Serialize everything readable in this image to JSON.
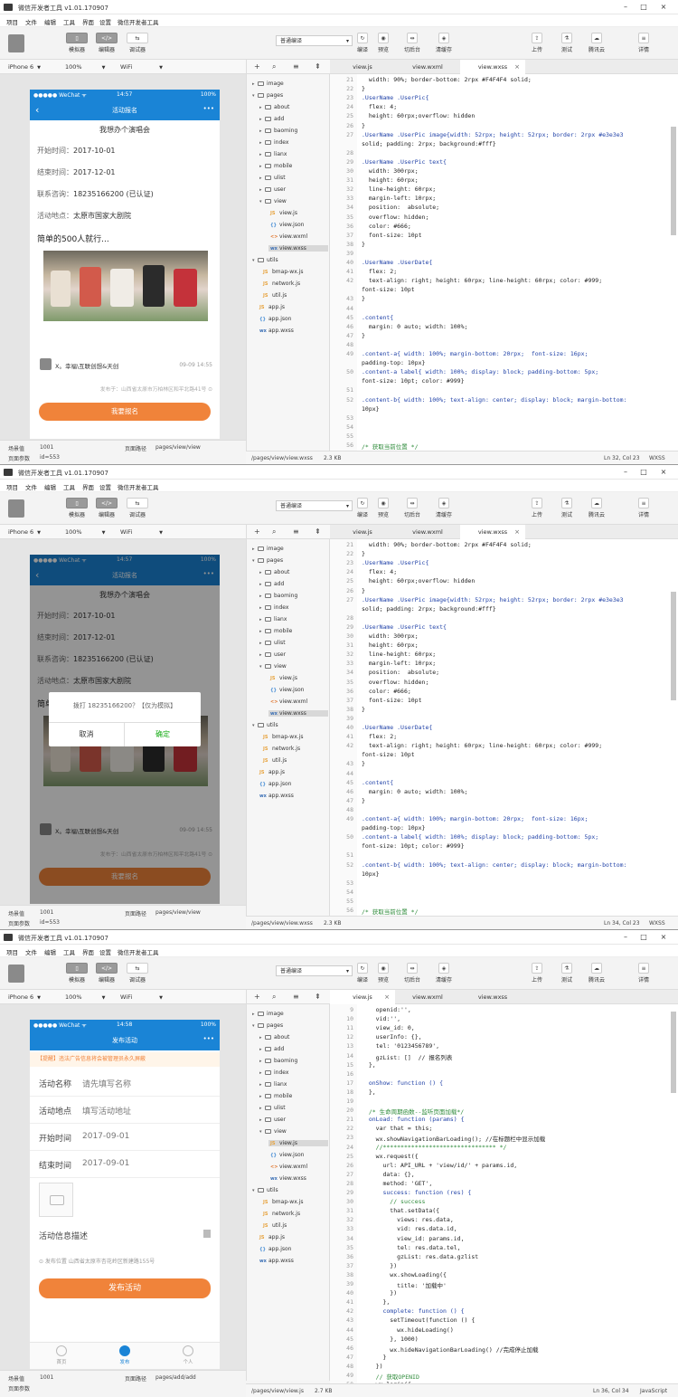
{
  "common": {
    "title": "微信开发者工具 v1.01.170907",
    "menus": [
      "项目",
      "文件",
      "编辑",
      "工具",
      "界面",
      "设置",
      "微信开发者工具"
    ],
    "toolbar": {
      "simulator": "模拟器",
      "editor": "编辑器",
      "debugger": "调试器",
      "mode": "普通编译",
      "compile": "编译",
      "preview": "预览",
      "background": "切后台",
      "cache": "清缓存",
      "upload": "上传",
      "test": "测试",
      "cloud": "腾讯云",
      "details": "详情"
    },
    "device": {
      "model": "iPhone 6",
      "zoom": "100%",
      "network": "WiFi"
    },
    "footer": {
      "scene_label": "场景值",
      "scene_value": "1001",
      "params_label": "页面参数",
      "path_label": "页面路径"
    },
    "files": {
      "image": "image",
      "pages": "pages",
      "about": "about",
      "add": "add",
      "baoming": "baoming",
      "index": "index",
      "lianx": "lianx",
      "mobile": "mobile",
      "ulist": "ulist",
      "user": "user",
      "view": "view",
      "view_js": "view.js",
      "view_json": "view.json",
      "view_wxml": "view.wxml",
      "view_wxss": "view.wxss",
      "utils": "utils",
      "bmap": "bmap-wx.js",
      "network": "network.js",
      "util": "util.js",
      "app_js": "app.js",
      "app_json": "app.json",
      "app_wxss": "app.wxss"
    },
    "tabs": [
      "view.js",
      "view.wxml",
      "view.wxss"
    ],
    "status_brand": "●●●●● WeChat ᯤ",
    "battery": "100%"
  },
  "panel1": {
    "time": "14:57",
    "nav_title": "活动报名",
    "event_title": "我想办个演唱会",
    "start_k": "开始时间：",
    "start_v": "2017-10-01",
    "end_k": "结束时间：",
    "end_v": "2017-12-01",
    "contact_k": "联系咨询：",
    "contact_v": "18235166200 (已认证)",
    "place_k": "活动地点：",
    "place_v": "太原市国家大剧院",
    "subtitle": "简单的500人就行...",
    "author": "X。幸福\\互联创想&天创",
    "date": "09-09 14:55",
    "addr": "发布于：山西省太原市万柏林区和平北路41号 ⊙",
    "cta": "我要报名",
    "params_value": "id=553",
    "path_value": "pages/view/view",
    "file_path": "/pages/view/view.wxss",
    "file_size": "2.3 KB",
    "cursor": "Ln 32, Col 23",
    "lang": "WXSS",
    "code": [
      [
        "21",
        "  width: 90%; border-bottom: 2rpx #F4F4F4 solid;"
      ],
      [
        "22",
        "}"
      ],
      [
        "23",
        ".UserName .UserPic{"
      ],
      [
        "24",
        "  flex: 4;"
      ],
      [
        "25",
        "  height: 60rpx;overflow: hidden"
      ],
      [
        "26",
        "}"
      ],
      [
        "27",
        ".UserName .UserPic image{width: 52rpx; height: 52rpx; border: 2rpx #e3e3e3"
      ],
      [
        "",
        "solid; padding: 2rpx; background:#fff}"
      ],
      [
        "28",
        ""
      ],
      [
        "29",
        ".UserName .UserPic text{"
      ],
      [
        "30",
        "  width: 300rpx;"
      ],
      [
        "31",
        "  height: 60rpx;"
      ],
      [
        "32",
        "  line-height: 60rpx;"
      ],
      [
        "33",
        "  margin-left: 10rpx;"
      ],
      [
        "34",
        "  position:  absolute;"
      ],
      [
        "35",
        "  overflow: hidden;"
      ],
      [
        "36",
        "  color: #666;"
      ],
      [
        "37",
        "  font-size: 10pt"
      ],
      [
        "38",
        "}"
      ],
      [
        "39",
        ""
      ],
      [
        "40",
        ".UserName .UserDate{"
      ],
      [
        "41",
        "  flex: 2;"
      ],
      [
        "42",
        "  text-align: right; height: 60rpx; line-height: 60rpx; color: #999;"
      ],
      [
        "",
        "font-size: 10pt"
      ],
      [
        "43",
        "}"
      ],
      [
        "44",
        ""
      ],
      [
        "45",
        ".content{"
      ],
      [
        "46",
        "  margin: 0 auto; width: 100%;"
      ],
      [
        "47",
        "}"
      ],
      [
        "48",
        ""
      ],
      [
        "49",
        ".content-a{ width: 100%; margin-bottom: 20rpx;  font-size: 16px;"
      ],
      [
        "",
        "padding-top: 10px}"
      ],
      [
        "50",
        ".content-a label{ width: 100%; display: block; padding-bottom: 5px;"
      ],
      [
        "",
        "font-size: 10pt; color: #999}"
      ],
      [
        "51",
        ""
      ],
      [
        "52",
        ".content-b{ width: 100%; text-align: center; display: block; margin-bottom:"
      ],
      [
        "",
        "10px}"
      ],
      [
        "53",
        ""
      ],
      [
        "54",
        ""
      ],
      [
        "55",
        ""
      ],
      [
        "56",
        "/* 获取当前位置 */"
      ]
    ]
  },
  "panel2": {
    "time": "14:57",
    "dialog_msg": "拨打 18235166200？【仅为模拟】",
    "dialog_cancel": "取消",
    "dialog_ok": "确定",
    "cursor": "Ln 34, Col 23"
  },
  "panel3": {
    "time": "14:58",
    "nav_title": "发布活动",
    "notice": "【提醒】违法广告信息将会被管理员永久屏蔽",
    "name_k": "活动名称",
    "name_v": "请先填写名称",
    "place_k": "活动地点",
    "place_v": "填写活动地址",
    "start_k": "开始时间",
    "start_v": "2017-09-01",
    "end_k": "结束时间",
    "end_v": "2017-09-01",
    "desc_k": "活动信息描述",
    "loc": "⊙  发布位置   山西省太原市杏花岭区新建路155号",
    "cta": "发布活动",
    "tab_home": "首页",
    "tab_publish": "发布",
    "tab_me": "个人",
    "path_value": "pages/add/add",
    "file_path": "/pages/view/view.js",
    "file_size": "2.7 KB",
    "cursor": "Ln 36, Col 34",
    "lang": "JavaScript",
    "code": [
      [
        "9",
        "    openid:'',"
      ],
      [
        "10",
        "    vid:'',"
      ],
      [
        "11",
        "    view_id: 0,"
      ],
      [
        "12",
        "    userInfo: {},"
      ],
      [
        "13",
        "    tel: '0123456789',"
      ],
      [
        "14",
        "    gzList: []  // 报名列表"
      ],
      [
        "15",
        "  },"
      ],
      [
        "16",
        ""
      ],
      [
        "17",
        "  onShow: function () {"
      ],
      [
        "18",
        "  },"
      ],
      [
        "19",
        ""
      ],
      [
        "20",
        "  /* 生命周期函数--监听页面加载*/"
      ],
      [
        "21",
        "  onLoad: function (params) {"
      ],
      [
        "22",
        "    var that = this;"
      ],
      [
        "23",
        "    wx.showNavigationBarLoading(); //在标题栏中显示加载"
      ],
      [
        "24",
        "    //******************************** */"
      ],
      [
        "25",
        "    wx.request({"
      ],
      [
        "26",
        "      url: API_URL + 'view/id/' + params.id,"
      ],
      [
        "27",
        "      data: {},"
      ],
      [
        "28",
        "      method: 'GET',"
      ],
      [
        "29",
        "      success: function (res) {"
      ],
      [
        "30",
        "        // success"
      ],
      [
        "31",
        "        that.setData({"
      ],
      [
        "32",
        "          views: res.data,"
      ],
      [
        "33",
        "          vid: res.data.id,"
      ],
      [
        "34",
        "          view_id: params.id,"
      ],
      [
        "35",
        "          tel: res.data.tel,"
      ],
      [
        "36",
        "          gzList: res.data.gzlist"
      ],
      [
        "37",
        "        })"
      ],
      [
        "38",
        "        wx.showLoading({"
      ],
      [
        "39",
        "          title: '加载中'"
      ],
      [
        "40",
        "        })"
      ],
      [
        "41",
        "      },"
      ],
      [
        "42",
        "      complete: function () {"
      ],
      [
        "43",
        "        setTimeout(function () {"
      ],
      [
        "44",
        "          wx.hideLoading()"
      ],
      [
        "45",
        "        }, 1000)"
      ],
      [
        "46",
        "        wx.hideNavigationBarLoading() //完成停止加载"
      ],
      [
        "47",
        "      }"
      ],
      [
        "48",
        "    })"
      ],
      [
        "49",
        "    // 获取OPENID"
      ],
      [
        "50",
        "    wx.login({"
      ]
    ]
  }
}
